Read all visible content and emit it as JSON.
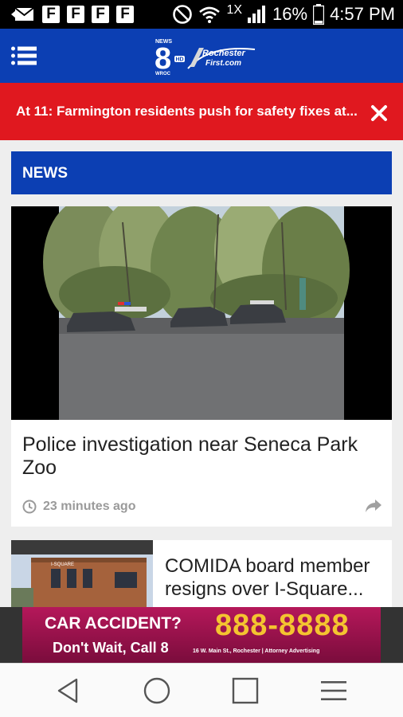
{
  "status_bar": {
    "notification_letters": [
      "F",
      "F",
      "F",
      "F"
    ],
    "network_label": "1X",
    "battery_percent": "16%",
    "time": "4:57 PM"
  },
  "app_bar": {
    "logo": {
      "station_number": "8",
      "news_label": "NEWS",
      "station_call": "WROC",
      "hd_label": "HD",
      "partner_name": "Rochester",
      "partner_site": "First.com"
    }
  },
  "breaking_banner": {
    "text": "At 11: Farmington residents push for safety fixes at..."
  },
  "section": {
    "title": "NEWS"
  },
  "articles": [
    {
      "title": "Police investigation near Seneca Park Zoo",
      "time_ago": "23 minutes ago"
    },
    {
      "title": "COMIDA board member resigns over I-Square...",
      "image_sign": "I-SQUARE"
    }
  ],
  "ad": {
    "headline": "CAR ACCIDENT?",
    "subline": "Don't Wait, Call 8",
    "phone": "888-8888",
    "fine_print": "16 W. Main St., Rochester | Attorney Advertising"
  },
  "colors": {
    "primary_blue": "#0c3fb3",
    "alert_red": "#e0181f",
    "ad_magenta": "#b5185a",
    "ad_gold": "#f4c430"
  },
  "icons": {
    "status": [
      "mail-icon",
      "flipboard-icon",
      "do-not-disturb-icon",
      "wifi-icon",
      "signal-icon",
      "battery-icon"
    ],
    "app_bar": [
      "hamburger-menu-icon",
      "station-logo"
    ],
    "banner": "close-icon",
    "article": [
      "clock-icon",
      "share-icon"
    ],
    "nav": [
      "back-icon",
      "home-icon",
      "recents-icon",
      "menu-icon"
    ]
  }
}
